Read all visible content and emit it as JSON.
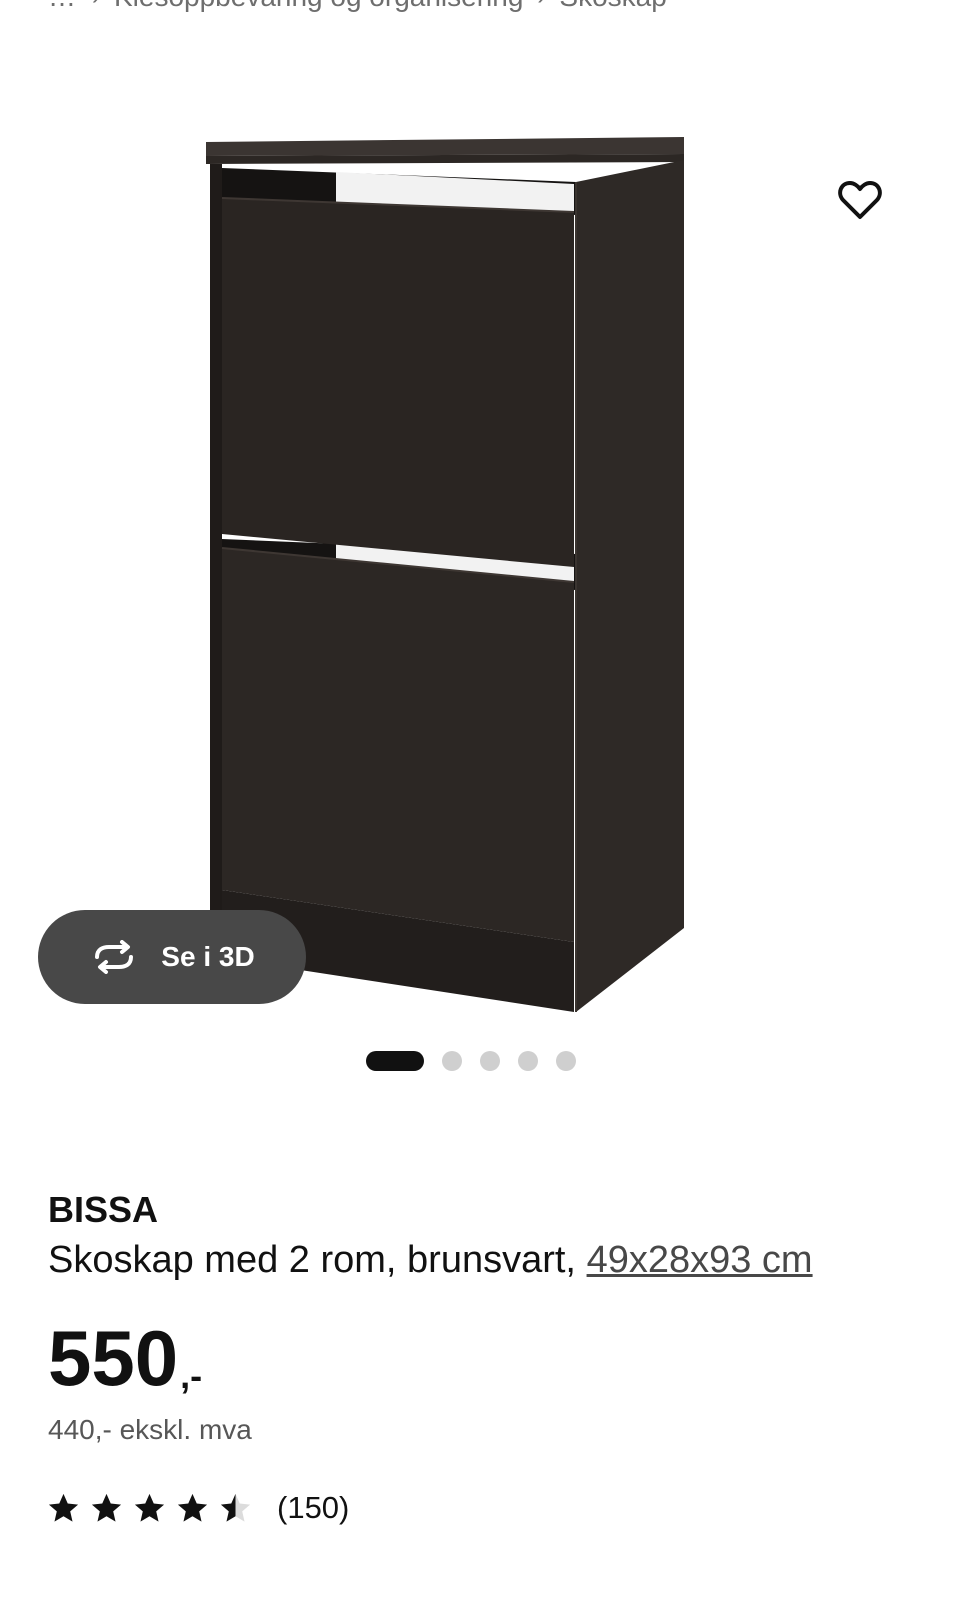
{
  "breadcrumb": {
    "items": [
      "Klesoppbevaring og organisering",
      "Skoskap"
    ]
  },
  "gallery": {
    "view_3d_label": "Se i 3D",
    "image_count": 5,
    "active_index": 0
  },
  "product": {
    "name": "BISSA",
    "description": "Skoskap med 2 rom, brunsvart,",
    "dimensions": "49x28x93 cm",
    "price_integer": "550",
    "price_suffix": ",-",
    "price_excl_vat": "440,- ekskl. mva",
    "rating_value": 4.5,
    "rating_max": 5,
    "review_count": "(150)"
  },
  "colors": {
    "product_wood": "#2a2522",
    "button_3d_bg": "#484848",
    "dot_active": "#111111",
    "dot_inactive": "#cfcfcf"
  }
}
